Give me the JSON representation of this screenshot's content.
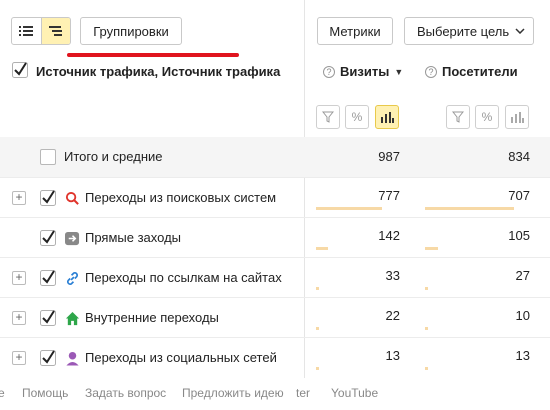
{
  "toolbar": {
    "groupings_label": "Группировки",
    "metrics_label": "Метрики",
    "goal_select_label": "Выберите цель"
  },
  "table": {
    "dimension_header": "Источник трафика, Источник трафика",
    "columns": [
      {
        "title": "Визиты",
        "sort": "desc",
        "sort_glyph": "▼"
      },
      {
        "title": "Посетители"
      }
    ],
    "total_label": "Итого и средние",
    "total_values": [
      "987",
      "834"
    ],
    "rows": [
      {
        "label": "Переходы из поисковых систем",
        "icon": "search-magnifier-icon",
        "expandable": true,
        "visits": "777",
        "visitors": "707",
        "visits_share": 0.787,
        "visitors_share": 0.848
      },
      {
        "label": "Прямые заходы",
        "icon": "arrow-right-icon",
        "expandable": false,
        "visits": "142",
        "visitors": "105",
        "visits_share": 0.144,
        "visitors_share": 0.126
      },
      {
        "label": "Переходы по ссылкам на сайтах",
        "icon": "link-icon",
        "expandable": true,
        "visits": "33",
        "visitors": "27",
        "visits_share": 0.033,
        "visitors_share": 0.032
      },
      {
        "label": "Внутренние переходы",
        "icon": "home-icon",
        "expandable": true,
        "visits": "22",
        "visitors": "10",
        "visits_share": 0.022,
        "visitors_share": 0.012
      },
      {
        "label": "Переходы из социальных сетей",
        "icon": "user-icon",
        "expandable": true,
        "visits": "13",
        "visitors": "13",
        "visits_share": 0.013,
        "visitors_share": 0.016
      }
    ]
  },
  "footer": {
    "links": [
      "e",
      "Помощь",
      "Задать вопрос",
      "Предложить идею",
      "ter",
      "YouTube"
    ]
  },
  "colors": {
    "accent_yellow": "#fff1b3",
    "bar": "#f7d9a6",
    "underline_red": "#e0141e",
    "check_yellow": "#ffdb4d",
    "search_red": "#e0342b",
    "link_blue": "#2a7fd4",
    "home_green": "#2ea64a",
    "user_purple": "#9b59b6",
    "arrow_gray": "#888888"
  }
}
